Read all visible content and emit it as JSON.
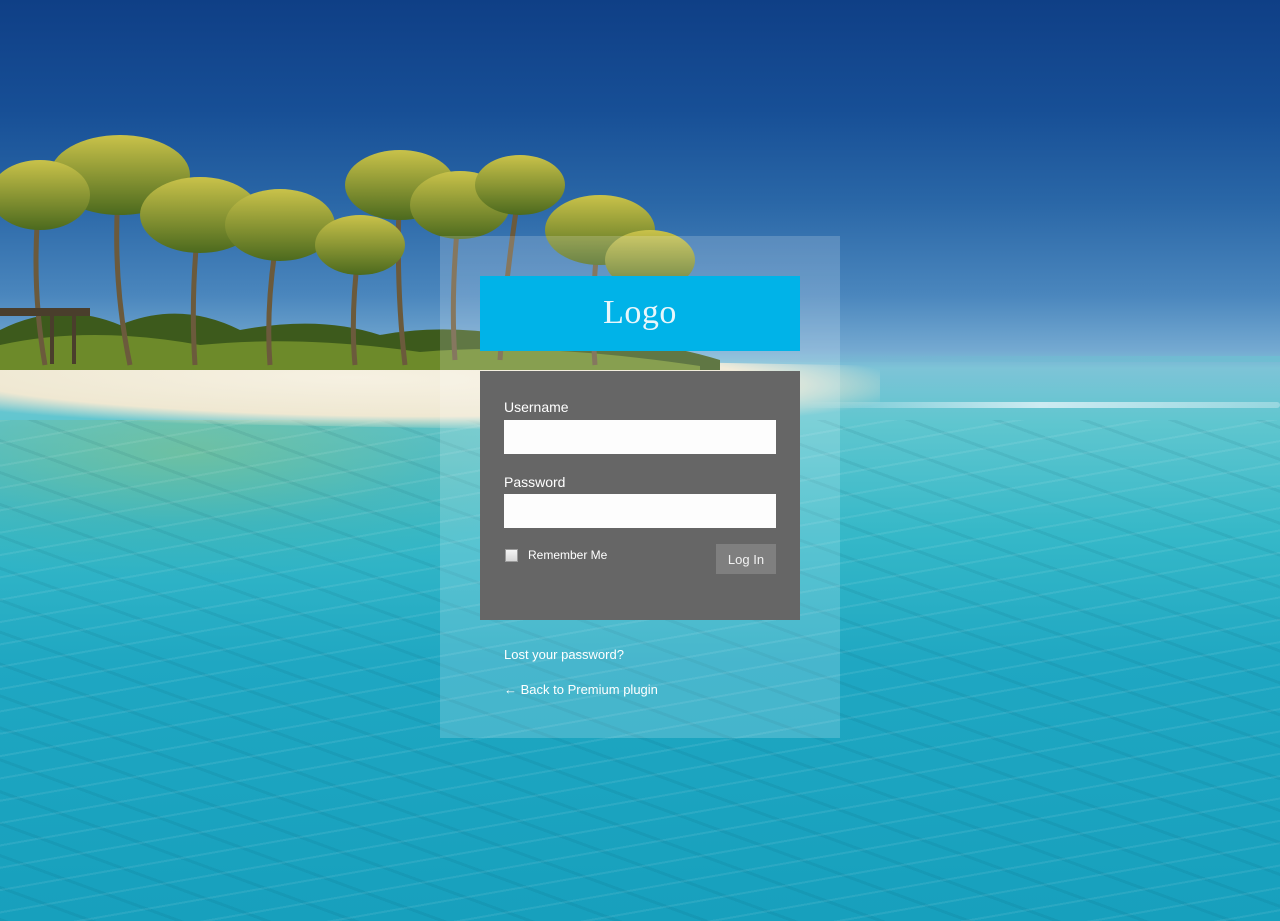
{
  "background": {
    "description_icon": "beach-palms-background"
  },
  "logo": {
    "text": "Logo",
    "color": "#00b3e8"
  },
  "form": {
    "username_label": "Username",
    "username_value": "",
    "password_label": "Password",
    "password_value": "",
    "remember_label": "Remember Me",
    "remember_checked": false,
    "login_label": "Log In",
    "panel_color": "#666666"
  },
  "links": {
    "lost_password": "Lost your password?",
    "back_to_site": "← Back to Premium plugin"
  }
}
